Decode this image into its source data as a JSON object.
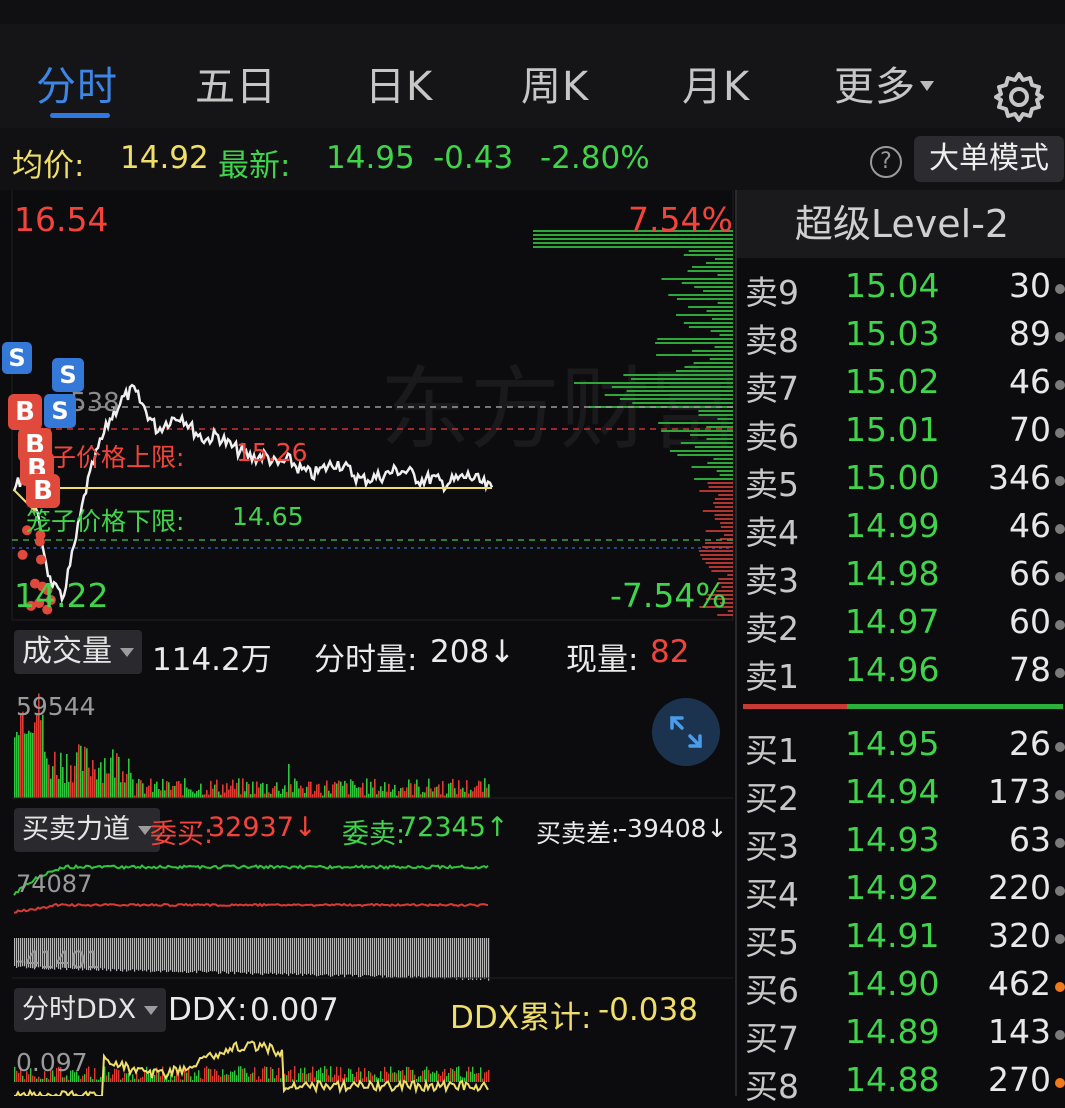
{
  "tabs": [
    {
      "label": "分时",
      "active": true
    },
    {
      "label": "五日"
    },
    {
      "label": "日K"
    },
    {
      "label": "周K"
    },
    {
      "label": "月K"
    },
    {
      "label": "更多"
    }
  ],
  "info": {
    "avg_label": "均价:",
    "avg_value": "14.92",
    "latest_label": "最新:",
    "latest_value": "14.95",
    "change": "-0.43",
    "change_pct": "-2.80%",
    "help": "?",
    "mode_button": "大单模式"
  },
  "price_chart": {
    "high_price": "16.54",
    "low_price": "14.22",
    "high_pct": "7.54%",
    "low_pct": "-7.54%",
    "upper_limit_label": "笼子价格上限:",
    "upper_limit_value": "15.26",
    "lower_limit_label": "笼子价格下限:",
    "lower_limit_value": "14.65",
    "ref_price_fragment": "538",
    "watermark": "东方财富",
    "markers": [
      "S",
      "S",
      "B",
      "S",
      "B",
      "B",
      "B"
    ]
  },
  "volume": {
    "selector": "成交量",
    "total": "114.2万",
    "minute_label": "分时量:",
    "minute_value": "208↓",
    "current_label": "现量:",
    "current_value": "82",
    "max_label": "59544"
  },
  "force": {
    "selector": "买卖力道",
    "bid_label": "委买:",
    "bid_value": "32937↓",
    "ask_label": "委卖:",
    "ask_value": "72345↑",
    "diff_label": "买卖差:",
    "diff_value": "-39408↓",
    "max_label": "74087",
    "min_label": "-41401"
  },
  "ddx": {
    "selector": "分时DDX",
    "ddx_label": "DDX:",
    "ddx_value": "0.007",
    "cum_label": "DDX累计:",
    "cum_value": "-0.038",
    "max_label": "0.097"
  },
  "order_book": {
    "title": "超级Level-2",
    "asks": [
      {
        "label": "卖9",
        "price": "15.04",
        "vol": "30",
        "dot": "gray"
      },
      {
        "label": "卖8",
        "price": "15.03",
        "vol": "89",
        "dot": "gray"
      },
      {
        "label": "卖7",
        "price": "15.02",
        "vol": "46",
        "dot": "gray"
      },
      {
        "label": "卖6",
        "price": "15.01",
        "vol": "70",
        "dot": "gray"
      },
      {
        "label": "卖5",
        "price": "15.00",
        "vol": "346",
        "dot": "gray"
      },
      {
        "label": "卖4",
        "price": "14.99",
        "vol": "46",
        "dot": "gray"
      },
      {
        "label": "卖3",
        "price": "14.98",
        "vol": "66",
        "dot": "gray"
      },
      {
        "label": "卖2",
        "price": "14.97",
        "vol": "60",
        "dot": "gray"
      },
      {
        "label": "卖1",
        "price": "14.96",
        "vol": "78",
        "dot": "gray"
      }
    ],
    "bids": [
      {
        "label": "买1",
        "price": "14.95",
        "vol": "26",
        "dot": "gray"
      },
      {
        "label": "买2",
        "price": "14.94",
        "vol": "173",
        "dot": "gray"
      },
      {
        "label": "买3",
        "price": "14.93",
        "vol": "63",
        "dot": "gray"
      },
      {
        "label": "买4",
        "price": "14.92",
        "vol": "220",
        "dot": "gray"
      },
      {
        "label": "买5",
        "price": "14.91",
        "vol": "320",
        "dot": "gray"
      },
      {
        "label": "买6",
        "price": "14.90",
        "vol": "462",
        "dot": "orange"
      },
      {
        "label": "买7",
        "price": "14.89",
        "vol": "143",
        "dot": "gray"
      },
      {
        "label": "买8",
        "price": "14.88",
        "vol": "270",
        "dot": "orange"
      }
    ]
  },
  "colors": {
    "accent_blue": "#3d86e6",
    "up_red": "#f2443a",
    "down_green": "#3fd44a",
    "avg_yellow": "#f0de6a"
  }
}
